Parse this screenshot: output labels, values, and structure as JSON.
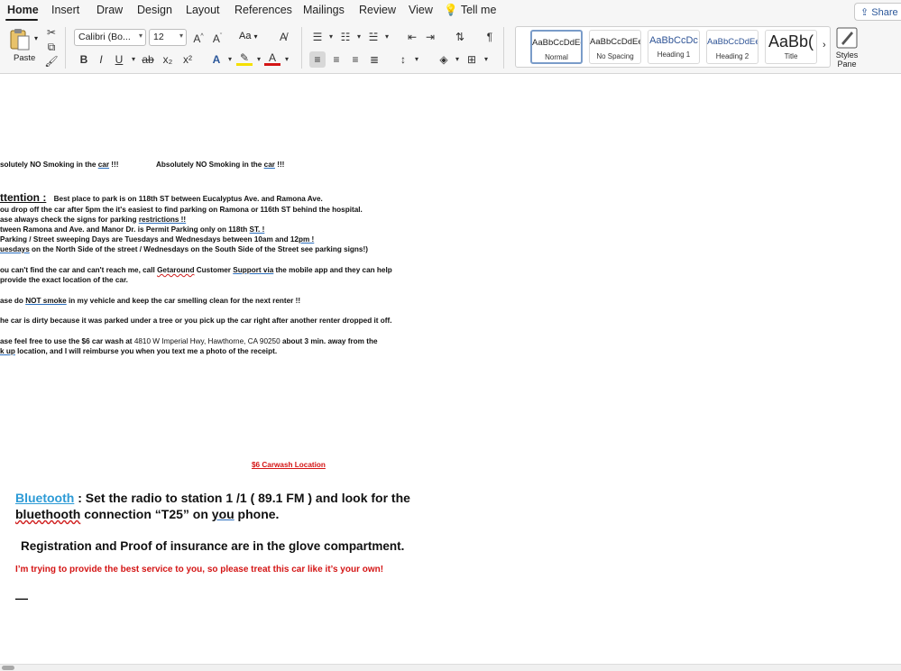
{
  "tabs": [
    "Home",
    "Insert",
    "Draw",
    "Design",
    "Layout",
    "References",
    "Mailings",
    "Review",
    "View"
  ],
  "tell_me": "Tell me",
  "share": "Share",
  "ribbon": {
    "paste": "Paste",
    "font_name": "Calibri (Bo...",
    "font_size": "12",
    "aa_label": "Aa",
    "bold": "B",
    "italic": "I",
    "underline": "U",
    "strike": "ab",
    "subscript": "x₂",
    "superscript": "x²",
    "styles": [
      {
        "sample": "AaBbCcDdEe",
        "name": "Normal"
      },
      {
        "sample": "AaBbCcDdEe",
        "name": "No Spacing"
      },
      {
        "sample": "AaBbCcDc",
        "name": "Heading 1"
      },
      {
        "sample": "AaBbCcDdEe",
        "name": "Heading 2"
      },
      {
        "sample": "AaBb(",
        "name": "Title"
      }
    ],
    "styles_pane": "Styles Pane"
  },
  "colors": {
    "highlight": "#f5e000",
    "font_color": "#d41515",
    "heading1": "#2f5496",
    "bluetooth_link": "#2d9bd6"
  },
  "document": {
    "no_smoking_1_pre": "solutely NO Smoking in the ",
    "no_smoking_1_car": "car",
    "no_smoking_1_post": " !!!",
    "no_smoking_2_pre": "Absolutely NO Smoking in the ",
    "no_smoking_2_car": "car",
    "no_smoking_2_post": " !!!",
    "attention_label": "ttention :",
    "attention_text": "Best place to park is on 118th ST between Eucalyptus Ave. and Ramona Ave.",
    "line2": "ou drop off the car after 5pm the it's easiest to find parking on Ramona or 116th ST behind the hospital.",
    "line3_pre": "ase always check the signs for parking ",
    "line3_link": "restrictions !!",
    "line4_pre": "tween Ramona and Ave. and Manor Dr. is Permit Parking only on 118th ",
    "line4_link": "ST. !",
    "line5_pre": " Parking / Street sweeping Days are Tuesdays and Wednesdays between 10am and 12",
    "line5_link": "pm !",
    "line6_link": "uesdays",
    "line6_post": " on the North Side of the street /  Wednesdays on the South Side of the Street see parking signs!)",
    "line7_pre": "ou can't find the car and can't reach me, call ",
    "line7_getaround": "Getaround",
    "line7_mid": " Customer ",
    "line7_support": "Support  via",
    "line7_post": " the mobile app and they can help",
    "line8": "provide the exact location of the car.",
    "line9_pre": "ase do ",
    "line9_not": "NOT  smoke",
    "line9_post": " in my vehicle and keep the car smelling clean for the next renter !!",
    "line10": "he car is dirty because it was parked under a tree or you pick up the car right after another renter dropped it off.",
    "line11_pre": "ase feel free to use the $6 car wash at ",
    "line11_addr": "4810 W Imperial Hwy, Hawthorne, CA 90250",
    "line11_post": "   about 3 min.  away from the",
    "line12_link": "k up",
    "line12_post": " location, and I will reimburse you when you text me a photo of the receipt.",
    "carwash_link": "$6 Carwash Location",
    "bluetooth_link": "Bluetooth",
    "bluetooth_colon": " :",
    "bluetooth_text": " Set the radio to station 1 /1 ( 89.1 FM ) and look  for the",
    "bluetooth_line2_word": "bluethooth",
    "bluetooth_line2_mid": " connection “T25” on ",
    "bluetooth_line2_you": "you",
    "bluetooth_line2_end": " phone.",
    "registration": "Registration and Proof of insurance are in the glove compartment.",
    "closing": "I’m trying to provide the best service to you, so please treat this car like it’s your own!",
    "dash": "—"
  }
}
